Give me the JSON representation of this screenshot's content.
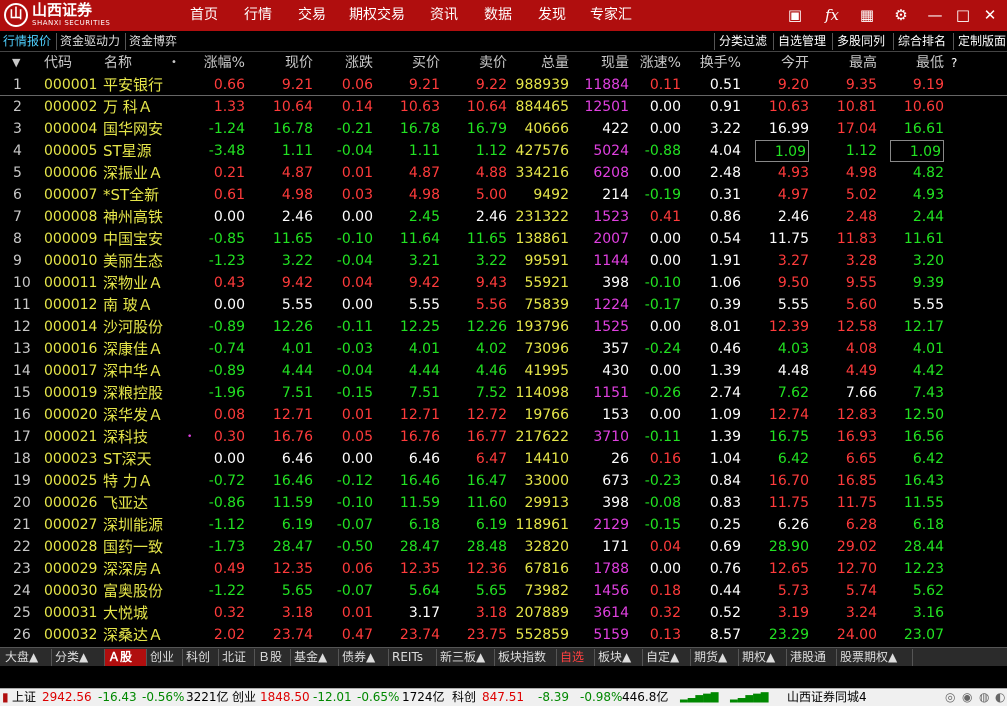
{
  "app": {
    "brand_cn": "山西证券",
    "brand_en": "SHANXI SECURITIES"
  },
  "top_menu": [
    "首页",
    "行情",
    "交易",
    "期权交易",
    "资讯",
    "数据",
    "发现",
    "专家汇"
  ],
  "title_icons": [
    "chat-board-icon",
    "function-fx-icon",
    "grid-layout-icon",
    "settings-gear-icon",
    "minimize-icon",
    "maximize-icon",
    "close-icon"
  ],
  "sub_tabs": [
    "行情报价",
    "资金驱动力",
    "资金博弈"
  ],
  "right_buttons": [
    "分类过滤",
    "自选管理",
    "多股同列",
    "综合排名",
    "定制版面"
  ],
  "columns": [
    "代码",
    "名称",
    "涨幅%",
    "现价",
    "涨跌",
    "买价",
    "卖价",
    "总量",
    "现量",
    "涨速%",
    "换手%",
    "今开",
    "最高",
    "最低"
  ],
  "colors": {
    "red": "#ff3b3b",
    "green": "#22e222",
    "white": "#ffffff",
    "yellow": "#e6e64a",
    "magenta": "#e040e0",
    "code": "#e6e64a"
  },
  "rows": [
    {
      "n": "1",
      "code": "000001",
      "name": "平安银行",
      "chg": "0.66",
      "price": "9.21",
      "diff": "0.06",
      "bid": "9.21",
      "ask": "9.22",
      "vol": "988939",
      "cur": "11884",
      "spd": "0.11",
      "turn": "0.51",
      "open": "9.20",
      "high": "9.35",
      "low": "9.19",
      "c": {
        "chg": "r",
        "price": "r",
        "diff": "r",
        "bid": "r",
        "ask": "r",
        "spd": "r",
        "open": "r",
        "high": "r",
        "low": "r"
      }
    },
    {
      "n": "2",
      "code": "000002",
      "name": "万 科Ａ",
      "chg": "1.33",
      "price": "10.64",
      "diff": "0.14",
      "bid": "10.63",
      "ask": "10.64",
      "vol": "884465",
      "cur": "12501",
      "spd": "0.00",
      "turn": "0.91",
      "open": "10.63",
      "high": "10.81",
      "low": "10.60",
      "c": {
        "chg": "r",
        "price": "r",
        "diff": "r",
        "bid": "r",
        "ask": "r",
        "spd": "w",
        "open": "r",
        "high": "r",
        "low": "r"
      }
    },
    {
      "n": "3",
      "code": "000004",
      "name": "国华网安",
      "chg": "-1.24",
      "price": "16.78",
      "diff": "-0.21",
      "bid": "16.78",
      "ask": "16.79",
      "vol": "40666",
      "cur": "422",
      "spd": "0.00",
      "turn": "3.22",
      "open": "16.99",
      "high": "17.04",
      "low": "16.61",
      "c": {
        "chg": "g",
        "price": "g",
        "diff": "g",
        "bid": "g",
        "ask": "g",
        "spd": "w",
        "open": "w",
        "high": "r",
        "low": "g"
      }
    },
    {
      "n": "4",
      "code": "000005",
      "name": "ST星源",
      "chg": "-3.48",
      "price": "1.11",
      "diff": "-0.04",
      "bid": "1.11",
      "ask": "1.12",
      "vol": "427576",
      "cur": "5024",
      "spd": "-0.88",
      "turn": "4.04",
      "open": "1.09",
      "high": "1.12",
      "low": "1.09",
      "c": {
        "chg": "g",
        "price": "g",
        "diff": "g",
        "bid": "g",
        "ask": "g",
        "spd": "g",
        "open": "g",
        "high": "g",
        "low": "g"
      },
      "box": true
    },
    {
      "n": "5",
      "code": "000006",
      "name": "深振业Ａ",
      "chg": "0.21",
      "price": "4.87",
      "diff": "0.01",
      "bid": "4.87",
      "ask": "4.88",
      "vol": "334216",
      "cur": "6208",
      "spd": "0.00",
      "turn": "2.48",
      "open": "4.93",
      "high": "4.98",
      "low": "4.82",
      "c": {
        "chg": "r",
        "price": "r",
        "diff": "r",
        "bid": "r",
        "ask": "r",
        "spd": "w",
        "open": "r",
        "high": "r",
        "low": "g"
      }
    },
    {
      "n": "6",
      "code": "000007",
      "name": "*ST全新",
      "chg": "0.61",
      "price": "4.98",
      "diff": "0.03",
      "bid": "4.98",
      "ask": "5.00",
      "vol": "9492",
      "cur": "214",
      "spd": "-0.19",
      "turn": "0.31",
      "open": "4.97",
      "high": "5.02",
      "low": "4.93",
      "c": {
        "chg": "r",
        "price": "r",
        "diff": "r",
        "bid": "r",
        "ask": "r",
        "spd": "g",
        "open": "r",
        "high": "r",
        "low": "g"
      }
    },
    {
      "n": "7",
      "code": "000008",
      "name": "神州高铁",
      "chg": "0.00",
      "price": "2.46",
      "diff": "0.00",
      "bid": "2.45",
      "ask": "2.46",
      "vol": "231322",
      "cur": "1523",
      "spd": "0.41",
      "turn": "0.86",
      "open": "2.46",
      "high": "2.48",
      "low": "2.44",
      "c": {
        "chg": "w",
        "price": "w",
        "diff": "w",
        "bid": "g",
        "ask": "w",
        "spd": "r",
        "open": "w",
        "high": "r",
        "low": "g"
      }
    },
    {
      "n": "8",
      "code": "000009",
      "name": "中国宝安",
      "chg": "-0.85",
      "price": "11.65",
      "diff": "-0.10",
      "bid": "11.64",
      "ask": "11.65",
      "vol": "138861",
      "cur": "2007",
      "spd": "0.00",
      "turn": "0.54",
      "open": "11.75",
      "high": "11.83",
      "low": "11.61",
      "c": {
        "chg": "g",
        "price": "g",
        "diff": "g",
        "bid": "g",
        "ask": "g",
        "spd": "w",
        "open": "w",
        "high": "r",
        "low": "g"
      }
    },
    {
      "n": "9",
      "code": "000010",
      "name": "美丽生态",
      "chg": "-1.23",
      "price": "3.22",
      "diff": "-0.04",
      "bid": "3.21",
      "ask": "3.22",
      "vol": "99591",
      "cur": "1144",
      "spd": "0.00",
      "turn": "1.91",
      "open": "3.27",
      "high": "3.28",
      "low": "3.20",
      "c": {
        "chg": "g",
        "price": "g",
        "diff": "g",
        "bid": "g",
        "ask": "g",
        "spd": "w",
        "open": "r",
        "high": "r",
        "low": "g"
      }
    },
    {
      "n": "10",
      "code": "000011",
      "name": "深物业Ａ",
      "chg": "0.43",
      "price": "9.42",
      "diff": "0.04",
      "bid": "9.42",
      "ask": "9.43",
      "vol": "55921",
      "cur": "398",
      "spd": "-0.10",
      "turn": "1.06",
      "open": "9.50",
      "high": "9.55",
      "low": "9.39",
      "c": {
        "chg": "r",
        "price": "r",
        "diff": "r",
        "bid": "r",
        "ask": "r",
        "spd": "g",
        "open": "r",
        "high": "r",
        "low": "g"
      }
    },
    {
      "n": "11",
      "code": "000012",
      "name": "南 玻Ａ",
      "chg": "0.00",
      "price": "5.55",
      "diff": "0.00",
      "bid": "5.55",
      "ask": "5.56",
      "vol": "75839",
      "cur": "1224",
      "spd": "-0.17",
      "turn": "0.39",
      "open": "5.55",
      "high": "5.60",
      "low": "5.55",
      "c": {
        "chg": "w",
        "price": "w",
        "diff": "w",
        "bid": "w",
        "ask": "r",
        "spd": "g",
        "open": "w",
        "high": "r",
        "low": "w"
      }
    },
    {
      "n": "12",
      "code": "000014",
      "name": "沙河股份",
      "chg": "-0.89",
      "price": "12.26",
      "diff": "-0.11",
      "bid": "12.25",
      "ask": "12.26",
      "vol": "193796",
      "cur": "1525",
      "spd": "0.00",
      "turn": "8.01",
      "open": "12.39",
      "high": "12.58",
      "low": "12.17",
      "c": {
        "chg": "g",
        "price": "g",
        "diff": "g",
        "bid": "g",
        "ask": "g",
        "spd": "w",
        "open": "r",
        "high": "r",
        "low": "g"
      }
    },
    {
      "n": "13",
      "code": "000016",
      "name": "深康佳Ａ",
      "chg": "-0.74",
      "price": "4.01",
      "diff": "-0.03",
      "bid": "4.01",
      "ask": "4.02",
      "vol": "73096",
      "cur": "357",
      "spd": "-0.24",
      "turn": "0.46",
      "open": "4.03",
      "high": "4.08",
      "low": "4.01",
      "c": {
        "chg": "g",
        "price": "g",
        "diff": "g",
        "bid": "g",
        "ask": "g",
        "spd": "g",
        "open": "g",
        "high": "r",
        "low": "g"
      }
    },
    {
      "n": "14",
      "code": "000017",
      "name": "深中华Ａ",
      "chg": "-0.89",
      "price": "4.44",
      "diff": "-0.04",
      "bid": "4.44",
      "ask": "4.46",
      "vol": "41995",
      "cur": "430",
      "spd": "0.00",
      "turn": "1.39",
      "open": "4.48",
      "high": "4.49",
      "low": "4.42",
      "c": {
        "chg": "g",
        "price": "g",
        "diff": "g",
        "bid": "g",
        "ask": "g",
        "spd": "w",
        "open": "w",
        "high": "r",
        "low": "g"
      }
    },
    {
      "n": "15",
      "code": "000019",
      "name": "深粮控股",
      "chg": "-1.96",
      "price": "7.51",
      "diff": "-0.15",
      "bid": "7.51",
      "ask": "7.52",
      "vol": "114098",
      "cur": "1151",
      "spd": "-0.26",
      "turn": "2.74",
      "open": "7.62",
      "high": "7.66",
      "low": "7.43",
      "c": {
        "chg": "g",
        "price": "g",
        "diff": "g",
        "bid": "g",
        "ask": "g",
        "spd": "g",
        "open": "g",
        "high": "w",
        "low": "g"
      }
    },
    {
      "n": "16",
      "code": "000020",
      "name": "深华发Ａ",
      "chg": "0.08",
      "price": "12.71",
      "diff": "0.01",
      "bid": "12.71",
      "ask": "12.72",
      "vol": "19766",
      "cur": "153",
      "spd": "0.00",
      "turn": "1.09",
      "open": "12.74",
      "high": "12.83",
      "low": "12.50",
      "c": {
        "chg": "r",
        "price": "r",
        "diff": "r",
        "bid": "r",
        "ask": "r",
        "spd": "w",
        "open": "r",
        "high": "r",
        "low": "g"
      }
    },
    {
      "n": "17",
      "code": "000021",
      "name": "深科技",
      "chg": "0.30",
      "price": "16.76",
      "diff": "0.05",
      "bid": "16.76",
      "ask": "16.77",
      "vol": "217622",
      "cur": "3710",
      "spd": "-0.11",
      "turn": "1.39",
      "open": "16.75",
      "high": "16.93",
      "low": "16.56",
      "c": {
        "chg": "r",
        "price": "r",
        "diff": "r",
        "bid": "r",
        "ask": "r",
        "spd": "g",
        "open": "g",
        "high": "r",
        "low": "g"
      },
      "dot": true
    },
    {
      "n": "18",
      "code": "000023",
      "name": "ST深天",
      "chg": "0.00",
      "price": "6.46",
      "diff": "0.00",
      "bid": "6.46",
      "ask": "6.47",
      "vol": "14410",
      "cur": "26",
      "spd": "0.16",
      "turn": "1.04",
      "open": "6.42",
      "high": "6.65",
      "low": "6.42",
      "c": {
        "chg": "w",
        "price": "w",
        "diff": "w",
        "bid": "w",
        "ask": "r",
        "spd": "r",
        "open": "g",
        "high": "r",
        "low": "g"
      }
    },
    {
      "n": "19",
      "code": "000025",
      "name": "特 力Ａ",
      "chg": "-0.72",
      "price": "16.46",
      "diff": "-0.12",
      "bid": "16.46",
      "ask": "16.47",
      "vol": "33000",
      "cur": "673",
      "spd": "-0.23",
      "turn": "0.84",
      "open": "16.70",
      "high": "16.85",
      "low": "16.43",
      "c": {
        "chg": "g",
        "price": "g",
        "diff": "g",
        "bid": "g",
        "ask": "g",
        "spd": "g",
        "open": "r",
        "high": "r",
        "low": "g"
      }
    },
    {
      "n": "20",
      "code": "000026",
      "name": "飞亚达",
      "chg": "-0.86",
      "price": "11.59",
      "diff": "-0.10",
      "bid": "11.59",
      "ask": "11.60",
      "vol": "29913",
      "cur": "398",
      "spd": "-0.08",
      "turn": "0.83",
      "open": "11.75",
      "high": "11.75",
      "low": "11.55",
      "c": {
        "chg": "g",
        "price": "g",
        "diff": "g",
        "bid": "g",
        "ask": "g",
        "spd": "g",
        "open": "r",
        "high": "r",
        "low": "g"
      }
    },
    {
      "n": "21",
      "code": "000027",
      "name": "深圳能源",
      "chg": "-1.12",
      "price": "6.19",
      "diff": "-0.07",
      "bid": "6.18",
      "ask": "6.19",
      "vol": "118961",
      "cur": "2129",
      "spd": "-0.15",
      "turn": "0.25",
      "open": "6.26",
      "high": "6.28",
      "low": "6.18",
      "c": {
        "chg": "g",
        "price": "g",
        "diff": "g",
        "bid": "g",
        "ask": "g",
        "spd": "g",
        "open": "w",
        "high": "r",
        "low": "g"
      }
    },
    {
      "n": "22",
      "code": "000028",
      "name": "国药一致",
      "chg": "-1.73",
      "price": "28.47",
      "diff": "-0.50",
      "bid": "28.47",
      "ask": "28.48",
      "vol": "32820",
      "cur": "171",
      "spd": "0.04",
      "turn": "0.69",
      "open": "28.90",
      "high": "29.02",
      "low": "28.44",
      "c": {
        "chg": "g",
        "price": "g",
        "diff": "g",
        "bid": "g",
        "ask": "g",
        "spd": "r",
        "open": "g",
        "high": "r",
        "low": "g"
      }
    },
    {
      "n": "23",
      "code": "000029",
      "name": "深深房Ａ",
      "chg": "0.49",
      "price": "12.35",
      "diff": "0.06",
      "bid": "12.35",
      "ask": "12.36",
      "vol": "67816",
      "cur": "1788",
      "spd": "0.00",
      "turn": "0.76",
      "open": "12.65",
      "high": "12.70",
      "low": "12.23",
      "c": {
        "chg": "r",
        "price": "r",
        "diff": "r",
        "bid": "r",
        "ask": "r",
        "spd": "w",
        "open": "r",
        "high": "r",
        "low": "g"
      }
    },
    {
      "n": "24",
      "code": "000030",
      "name": "富奥股份",
      "chg": "-1.22",
      "price": "5.65",
      "diff": "-0.07",
      "bid": "5.64",
      "ask": "5.65",
      "vol": "73982",
      "cur": "1456",
      "spd": "0.18",
      "turn": "0.44",
      "open": "5.73",
      "high": "5.74",
      "low": "5.62",
      "c": {
        "chg": "g",
        "price": "g",
        "diff": "g",
        "bid": "g",
        "ask": "g",
        "spd": "r",
        "open": "r",
        "high": "r",
        "low": "g"
      }
    },
    {
      "n": "25",
      "code": "000031",
      "name": "大悦城",
      "chg": "0.32",
      "price": "3.18",
      "diff": "0.01",
      "bid": "3.17",
      "ask": "3.18",
      "vol": "207889",
      "cur": "3614",
      "spd": "0.32",
      "turn": "0.52",
      "open": "3.19",
      "high": "3.24",
      "low": "3.16",
      "c": {
        "chg": "r",
        "price": "r",
        "diff": "r",
        "bid": "w",
        "ask": "r",
        "spd": "r",
        "open": "r",
        "high": "r",
        "low": "g"
      }
    },
    {
      "n": "26",
      "code": "000032",
      "name": "深桑达Ａ",
      "chg": "2.02",
      "price": "23.74",
      "diff": "0.47",
      "bid": "23.74",
      "ask": "23.75",
      "vol": "552859",
      "cur": "5159",
      "spd": "0.13",
      "turn": "8.57",
      "open": "23.29",
      "high": "24.00",
      "low": "23.07",
      "c": {
        "chg": "r",
        "price": "r",
        "diff": "r",
        "bid": "r",
        "ask": "r",
        "spd": "r",
        "open": "g",
        "high": "r",
        "low": "g"
      }
    }
  ],
  "bottom_tabs": [
    "大盘▲",
    "分类▲",
    "Ａ股",
    "创业",
    "科创",
    "北证",
    "Ｂ股",
    "基金▲",
    "债券▲",
    "REITs",
    "新三板▲",
    "板块指数",
    "自选",
    "板块▲",
    "自定▲",
    "期货▲",
    "期权▲",
    "港股通",
    "股票期权▲"
  ],
  "status": {
    "sh_label": "上证",
    "sh_price": "2942.56",
    "sh_chg": "-16.43",
    "sh_pct": "-0.56%",
    "sh_amt": "3221亿",
    "cy_label": "创业",
    "cy_price": "1848.50",
    "cy_chg": "-12.01",
    "cy_pct": "-0.65%",
    "cy_amt": "1724亿",
    "kc_label": "科创",
    "kc_price": "847.51",
    "kc_chg": "-8.39",
    "kc_pct": "-0.98%",
    "kc_amt": "446.8亿",
    "server": "山西证券同城4"
  }
}
